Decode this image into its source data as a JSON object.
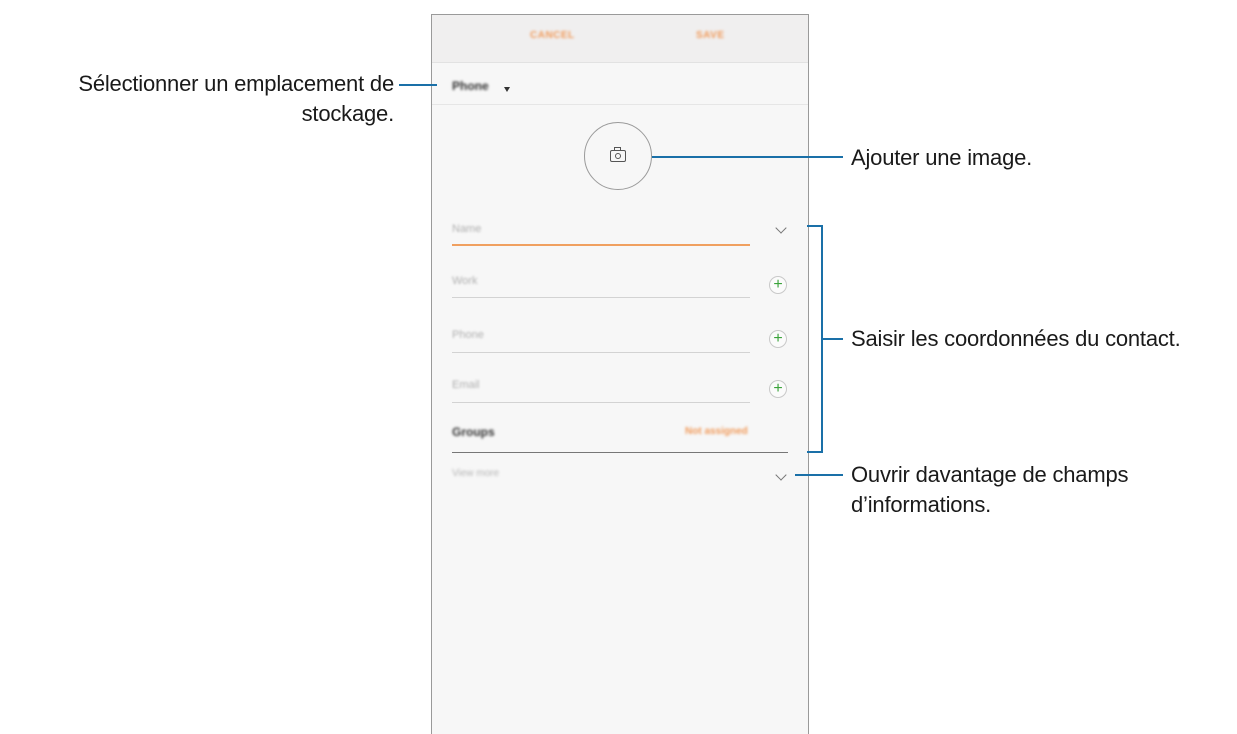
{
  "phone": {
    "topbar": {
      "cancel_label": "CANCEL",
      "save_label": "SAVE"
    },
    "storage_location": "Phone",
    "fields": [
      {
        "placeholder": "Name",
        "action": "chevron-down-icon"
      },
      {
        "placeholder": "Work",
        "action": "plus-icon"
      },
      {
        "placeholder": "Phone",
        "action": "plus-icon"
      },
      {
        "placeholder": "Email",
        "action": "plus-icon"
      }
    ],
    "groups": {
      "label": "Groups",
      "value": "Not assigned"
    },
    "view_more": "View more"
  },
  "annotations": {
    "storage": [
      "Sélectionner un emplacement de",
      "stockage."
    ],
    "image": "Ajouter une image.",
    "contact_info": "Saisir les coordonnées du contact.",
    "more_fields": [
      "Ouvrir davantage de champs",
      "d’informations."
    ]
  },
  "colors": {
    "accent": "#f09a5a",
    "callout_line": "#1a70a8",
    "plus_icon": "#3aa33a"
  }
}
